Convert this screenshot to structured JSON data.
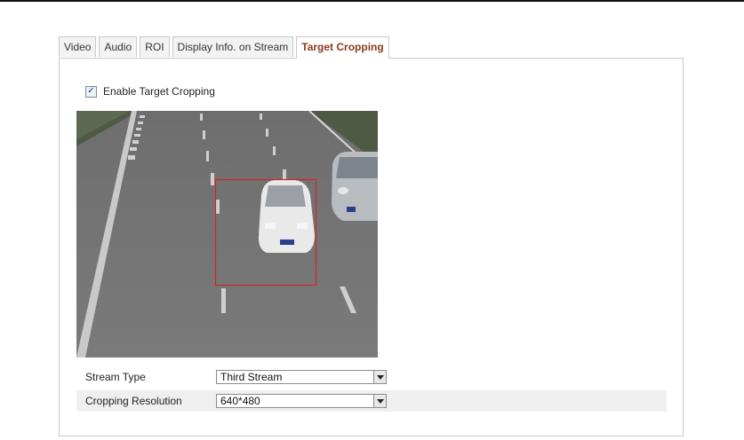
{
  "tabs": [
    {
      "label": "Video"
    },
    {
      "label": "Audio"
    },
    {
      "label": "ROI"
    },
    {
      "label": "Display Info. on Stream"
    },
    {
      "label": "Target Cropping"
    }
  ],
  "active_tab": "Target Cropping",
  "enable_cropping": {
    "label": "Enable Target Cropping",
    "checked": true
  },
  "form": {
    "stream_type": {
      "label": "Stream Type",
      "value": "Third Stream"
    },
    "cropping_resolution": {
      "label": "Cropping Resolution",
      "value": "640*480"
    }
  },
  "colors": {
    "active_tab_text": "#8b3a1a",
    "crop_box": "#d4242a"
  }
}
